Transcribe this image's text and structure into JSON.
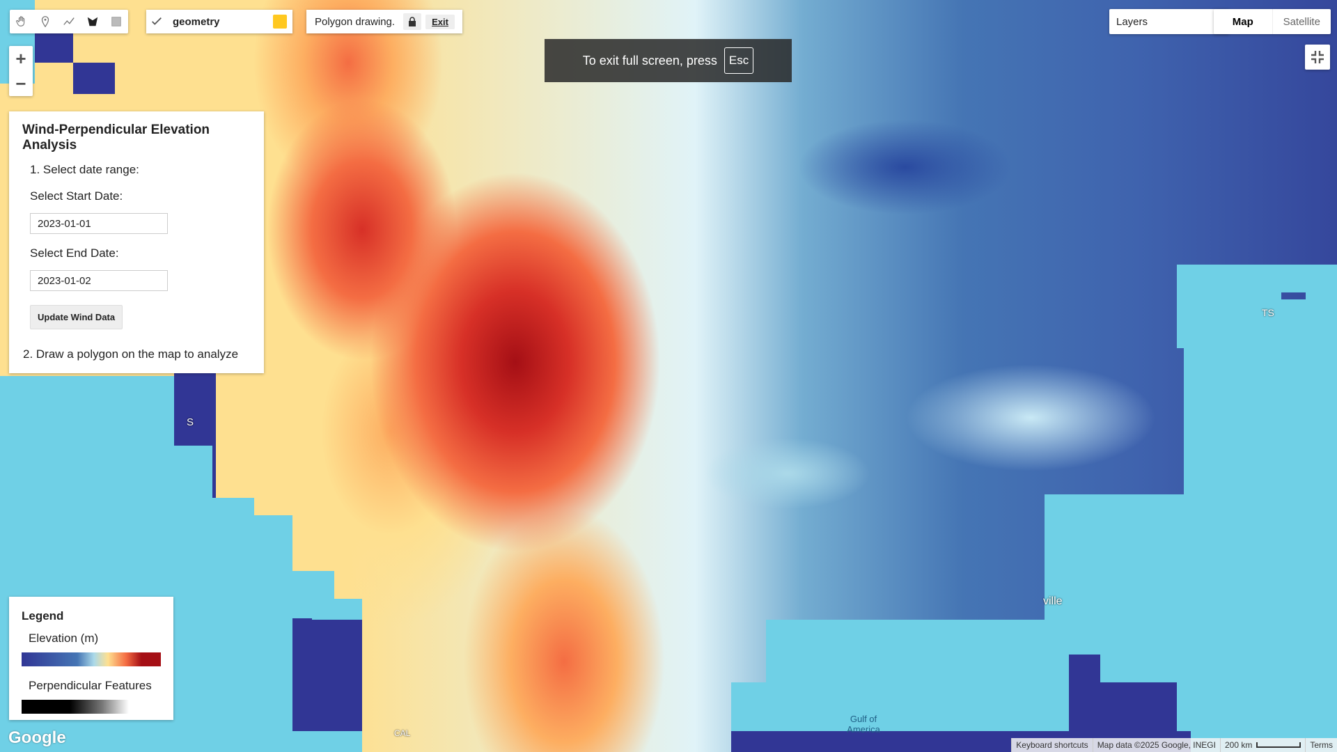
{
  "toolbar": {
    "tools": [
      "pan-hand-icon",
      "marker-icon",
      "polyline-icon",
      "polygon-icon",
      "rectangle-icon"
    ]
  },
  "geometry_layer": {
    "name": "geometry",
    "swatch_color": "#ffc820"
  },
  "polygon_bar": {
    "status": "Polygon drawing.",
    "exit_label": "Exit"
  },
  "fullscreen_notice": {
    "text": "To exit full screen, press",
    "key": "Esc"
  },
  "layers": {
    "label": "Layers"
  },
  "map_type": {
    "map_label": "Map",
    "satellite_label": "Satellite"
  },
  "zoom": {
    "in_label": "+",
    "out_label": "−"
  },
  "panel": {
    "title": "Wind-Perpendicular Elevation Analysis",
    "step1": "1. Select date range:",
    "start_label": "Select Start Date:",
    "start_value": "2023-01-01",
    "end_label": "Select End Date:",
    "end_value": "2023-01-02",
    "update_button": "Update Wind Data",
    "step2": "2. Draw a polygon on the map to analyze"
  },
  "legend": {
    "title": "Legend",
    "elevation_label": "Elevation (m)",
    "perpendicular_label": "Perpendicular Features"
  },
  "map_labels": {
    "gulf": "Gulf of\nAmerica",
    "ville": "ville",
    "ts": "TS",
    "s": "S",
    "cal": "CAL"
  },
  "footer": {
    "shortcuts": "Keyboard shortcuts",
    "map_data": "Map data ©2025 Google, INEGI",
    "scale": "200 km",
    "terms": "Terms"
  },
  "google_logo": "Google"
}
